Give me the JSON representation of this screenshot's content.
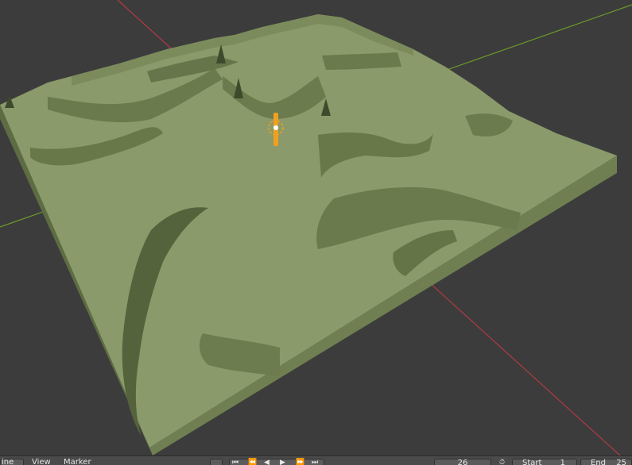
{
  "viewport": {
    "colors": {
      "background": "#3c3c3c",
      "terrain_top": "#8a9a6a",
      "terrain_side": "#6f7f52",
      "terrain_dark": "#55633c",
      "x_axis": "#b03a44",
      "y_axis": "#6b9a2a",
      "light_object": "#f0a020"
    },
    "objects": [
      "terrain-mesh",
      "light-object",
      "x-axis-line",
      "y-axis-line"
    ]
  },
  "timeline": {
    "editor_label": "ine",
    "menu_view": "View",
    "menu_marker": "Marker",
    "record_icon": "record-icon",
    "playback_icons": [
      "jump-start-icon",
      "prev-keyframe-icon",
      "play-reverse-icon",
      "play-icon",
      "next-keyframe-icon",
      "jump-end-icon"
    ],
    "current_frame": "26",
    "start_label": "Start",
    "start_value": "1",
    "end_label": "End",
    "end_value": "25"
  }
}
